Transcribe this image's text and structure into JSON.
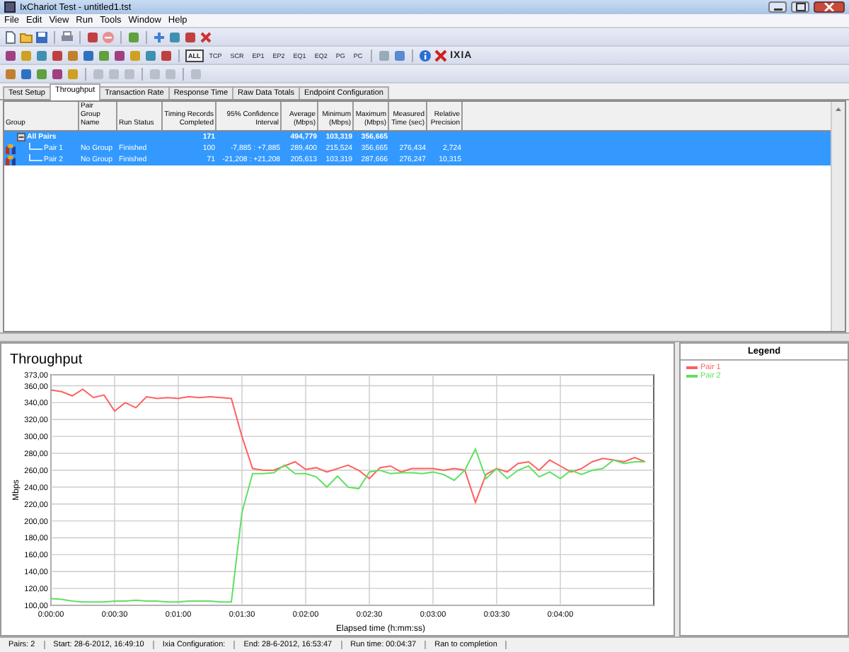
{
  "window": {
    "title": "IxChariot Test - untitled1.tst"
  },
  "menu": [
    "File",
    "Edit",
    "View",
    "Run",
    "Tools",
    "Window",
    "Help"
  ],
  "protocol_filters": [
    {
      "label": "ALL",
      "selected": true
    },
    {
      "label": "TCP",
      "selected": false
    },
    {
      "label": "SCR",
      "selected": false
    },
    {
      "label": "EP1",
      "selected": false
    },
    {
      "label": "EP2",
      "selected": false
    },
    {
      "label": "EQ1",
      "selected": false
    },
    {
      "label": "EQ2",
      "selected": false
    },
    {
      "label": "PG",
      "selected": false
    },
    {
      "label": "PC",
      "selected": false
    }
  ],
  "logo": "IXIA",
  "tabs": [
    {
      "label": "Test Setup",
      "selected": false
    },
    {
      "label": "Throughput",
      "selected": true
    },
    {
      "label": "Transaction Rate",
      "selected": false
    },
    {
      "label": "Response Time",
      "selected": false
    },
    {
      "label": "Raw Data Totals",
      "selected": false
    },
    {
      "label": "Endpoint Configuration",
      "selected": false
    }
  ],
  "table": {
    "columns": [
      "Group",
      "Pair Group Name",
      "Run Status",
      "Timing Records Completed",
      "95% Confidence Interval",
      "Average (Mbps)",
      "Minimum (Mbps)",
      "Maximum (Mbps)",
      "Measured Time (sec)",
      "Relative Precision"
    ],
    "rows": [
      {
        "kind": "group",
        "selected": true,
        "expanded": true,
        "cells": [
          "All Pairs",
          "",
          "",
          "171",
          "",
          "494,779",
          "103,319",
          "356,665",
          "",
          ""
        ]
      },
      {
        "kind": "pair",
        "selected": true,
        "cells": [
          "Pair 1",
          "No Group",
          "Finished",
          "100",
          "-7,885 : +7,885",
          "289,400",
          "215,524",
          "356,665",
          "276,434",
          "2,724"
        ]
      },
      {
        "kind": "pair",
        "selected": true,
        "cells": [
          "Pair 2",
          "No Group",
          "Finished",
          "71",
          "-21,208 : +21,208",
          "205,613",
          "103,319",
          "287,666",
          "276,247",
          "10,315"
        ]
      }
    ]
  },
  "chart": {
    "chart_data": {
      "type": "line",
      "title": "Throughput",
      "xlabel": "Elapsed time (h:mm:ss)",
      "ylabel": "Mbps",
      "x": [
        0,
        5,
        10,
        15,
        20,
        25,
        30,
        35,
        40,
        45,
        50,
        55,
        60,
        65,
        70,
        75,
        80,
        85,
        90,
        95,
        100,
        105,
        110,
        115,
        120,
        125,
        130,
        135,
        140,
        145,
        150,
        155,
        160,
        165,
        170,
        175,
        180,
        185,
        190,
        195,
        200,
        205,
        210,
        215,
        220,
        225,
        230,
        235,
        240,
        245,
        250,
        255,
        260,
        265,
        270,
        275,
        280
      ],
      "series": [
        {
          "name": "Pair 1",
          "color": "#ff6060",
          "values": [
            355,
            353,
            348,
            356,
            346,
            349,
            330,
            340,
            334,
            347,
            345,
            346,
            345,
            347,
            346,
            347,
            346,
            345,
            300,
            262,
            260,
            260,
            265,
            270,
            261,
            263,
            258,
            262,
            266,
            260,
            250,
            263,
            265,
            258,
            262,
            262,
            262,
            260,
            262,
            260,
            222,
            255,
            262,
            258,
            268,
            270,
            260,
            272,
            265,
            258,
            262,
            270,
            274,
            272,
            270,
            275,
            270
          ]
        },
        {
          "name": "Pair 2",
          "color": "#60e060",
          "values": [
            108,
            107,
            105,
            104,
            104,
            104,
            105,
            105,
            106,
            105,
            105,
            104,
            104,
            105,
            105,
            105,
            104,
            104,
            210,
            256,
            256,
            257,
            266,
            256,
            256,
            252,
            240,
            253,
            240,
            238,
            258,
            260,
            256,
            257,
            257,
            256,
            258,
            255,
            248,
            260,
            285,
            250,
            262,
            250,
            260,
            265,
            252,
            258,
            250,
            260,
            255,
            260,
            262,
            272,
            268,
            270,
            270
          ]
        }
      ],
      "grid": true,
      "xlim": [
        0,
        284
      ],
      "ylim": [
        100,
        373
      ],
      "xticks": [
        {
          "value": 0,
          "label": "0:00:00"
        },
        {
          "value": 30,
          "label": "0:00:30"
        },
        {
          "value": 60,
          "label": "0:01:00"
        },
        {
          "value": 90,
          "label": "0:01:30"
        },
        {
          "value": 120,
          "label": "0:02:00"
        },
        {
          "value": 150,
          "label": "0:02:30"
        },
        {
          "value": 180,
          "label": "0:03:00"
        },
        {
          "value": 210,
          "label": "0:03:30"
        },
        {
          "value": 240,
          "label": "0:04:00"
        }
      ],
      "yticks": [
        {
          "value": 100,
          "label": "100,00"
        },
        {
          "value": 120,
          "label": "120,00"
        },
        {
          "value": 140,
          "label": "140,00"
        },
        {
          "value": 160,
          "label": "160,00"
        },
        {
          "value": 180,
          "label": "180,00"
        },
        {
          "value": 200,
          "label": "200,00"
        },
        {
          "value": 220,
          "label": "220,00"
        },
        {
          "value": 240,
          "label": "240,00"
        },
        {
          "value": 260,
          "label": "260,00"
        },
        {
          "value": 280,
          "label": "280,00"
        },
        {
          "value": 300,
          "label": "300,00"
        },
        {
          "value": 320,
          "label": "320,00"
        },
        {
          "value": 340,
          "label": "340,00"
        },
        {
          "value": 360,
          "label": "360,00"
        },
        {
          "value": 373,
          "label": "373,00"
        }
      ]
    }
  },
  "legend": {
    "title": "Legend"
  },
  "status_bar": [
    "Pairs: 2",
    "Start: 28-6-2012, 16:49:10",
    "Ixia Configuration:",
    "End: 28-6-2012, 16:53:47",
    "Run time: 00:04:37",
    "Ran to completion"
  ]
}
